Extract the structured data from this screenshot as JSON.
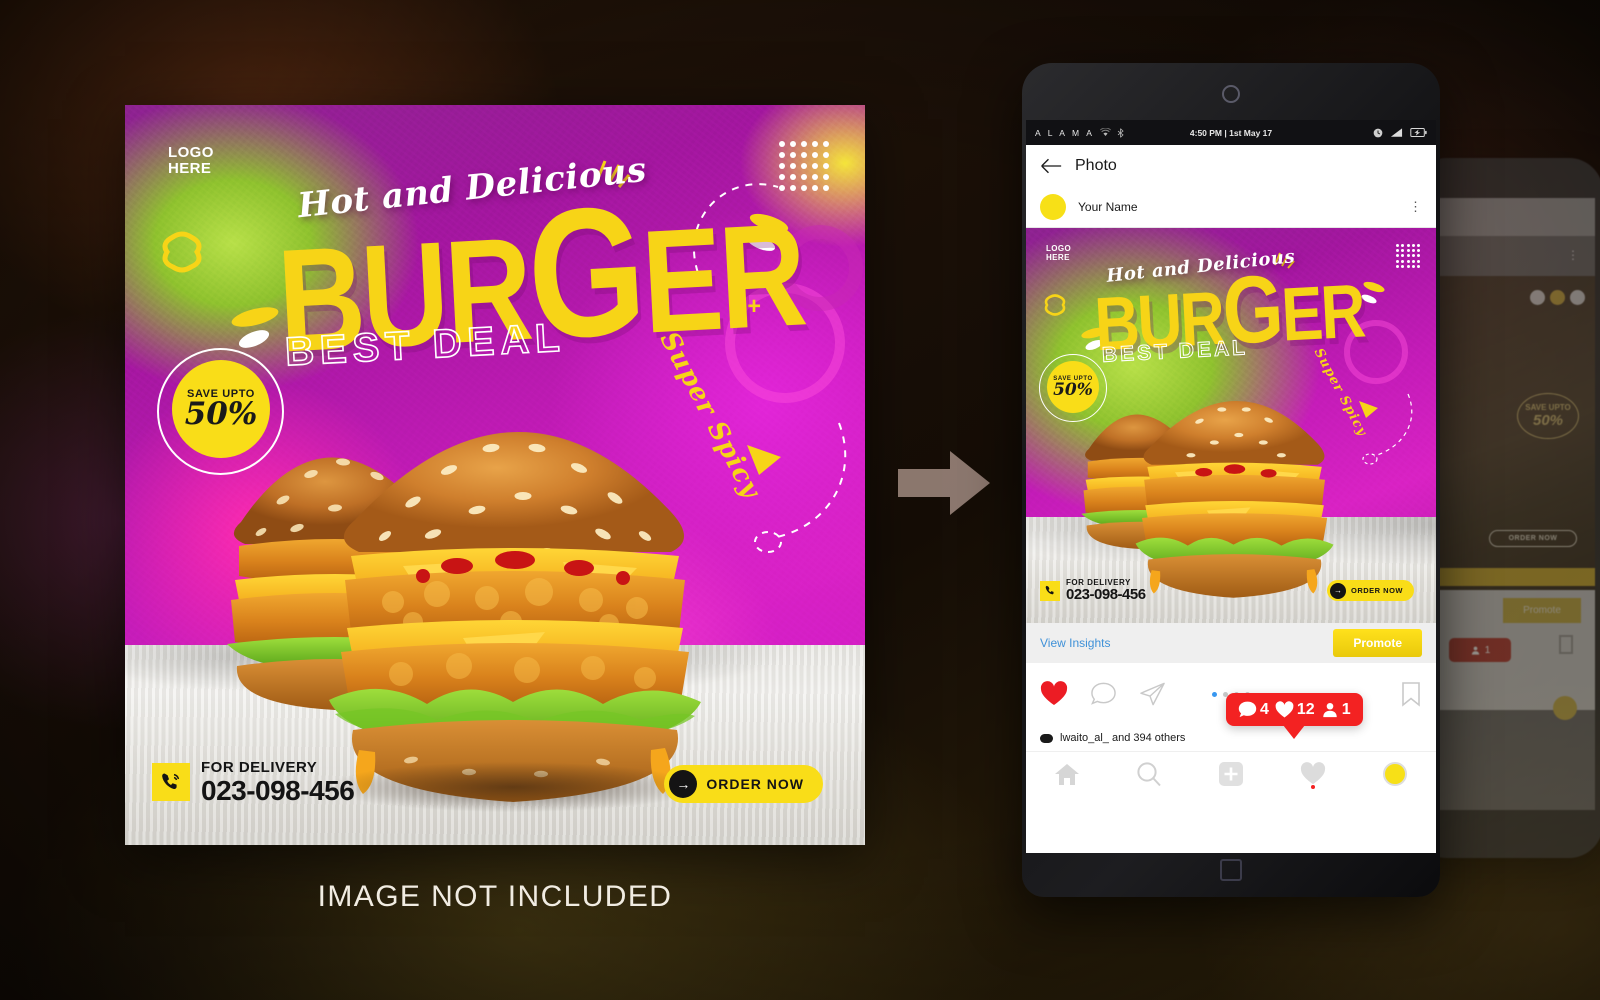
{
  "canvas": {
    "background_note": "dark brown/olive gradient backdrop"
  },
  "poster": {
    "logo_line1": "LOGO",
    "logo_line2": "HERE",
    "tagline": "Hot and Delicious",
    "headline_part1": "BUR",
    "headline_part2": "G",
    "headline_part3": "ER",
    "subheadline": "BEST DEAL",
    "side_label": "Super Spicy",
    "badge_top": "SAVE UPTO",
    "badge_value": "50%",
    "delivery_label": "FOR DELIVERY",
    "delivery_phone": "023-098-456",
    "cta_label": "ORDER NOW",
    "cta_arrow": "→",
    "caption": "IMAGE NOT INCLUDED",
    "icons": {
      "dot_grid": "dot-grid-icon",
      "phone": "phone-call-icon",
      "arrow": "arrow-right-icon"
    },
    "colors": {
      "yellow": "#F9DD18",
      "magenta": "#C41BB8",
      "purple": "#8D2390",
      "dark": "#141414"
    }
  },
  "transition": {
    "icon": "arrow-right-icon"
  },
  "phone": {
    "statusbar": {
      "carrier": "A L A M A",
      "wifi_icon": "wifi-icon",
      "bluetooth_icon": "bluetooth-icon",
      "time": "4:50 PM | 1st May 17",
      "alarm_icon": "alarm-clock-icon",
      "signal_icon": "signal-bars-icon",
      "battery_icon": "battery-icon"
    },
    "header": {
      "back_icon": "back-arrow-icon",
      "title": "Photo"
    },
    "user": {
      "avatar": "user-avatar",
      "name": "Your Name",
      "menu_icon": "kebab-menu-icon"
    },
    "post": {
      "logo_line1": "LOGO",
      "logo_line2": "HERE",
      "tagline": "Hot and Delicious",
      "headline_part1": "BUR",
      "headline_part2": "G",
      "headline_part3": "ER",
      "subheadline": "BEST DEAL",
      "side_label": "Super Spicy",
      "badge_top": "SAVE UPTO",
      "badge_value": "50%",
      "delivery_label": "FOR DELIVERY",
      "delivery_phone": "023-098-456",
      "cta_label": "ORDER NOW",
      "cta_arrow": "→"
    },
    "insights": {
      "view_insights_label": "View Insights",
      "promote_label": "Promote"
    },
    "actions": {
      "like_icon": "heart-icon",
      "comment_icon": "comment-bubble-icon",
      "share_icon": "send-paper-plane-icon",
      "bookmark_icon": "bookmark-icon",
      "pager_dots": 4,
      "pager_active_index": 0
    },
    "notification_badge": {
      "comment_icon": "comment-bubble-icon",
      "comment_count": "4",
      "like_icon": "heart-icon",
      "like_count": "12",
      "follower_icon": "person-icon",
      "follower_count": "1",
      "color": "#F32222"
    },
    "likes_row": {
      "text": "lwaito_al_ and 394 others"
    },
    "tabbar": {
      "home_icon": "home-icon",
      "search_icon": "search-icon",
      "add_icon": "plus-square-icon",
      "activity_icon": "heart-icon",
      "profile_icon": "profile-avatar-icon"
    },
    "homebutton_icon": "home-square-icon"
  },
  "ghost_phone": {
    "promote_label": "Promote",
    "cta_label": "ORDER NOW",
    "badge_top": "SAVE UPTO",
    "badge_value": "50%",
    "follower_count": "1"
  }
}
